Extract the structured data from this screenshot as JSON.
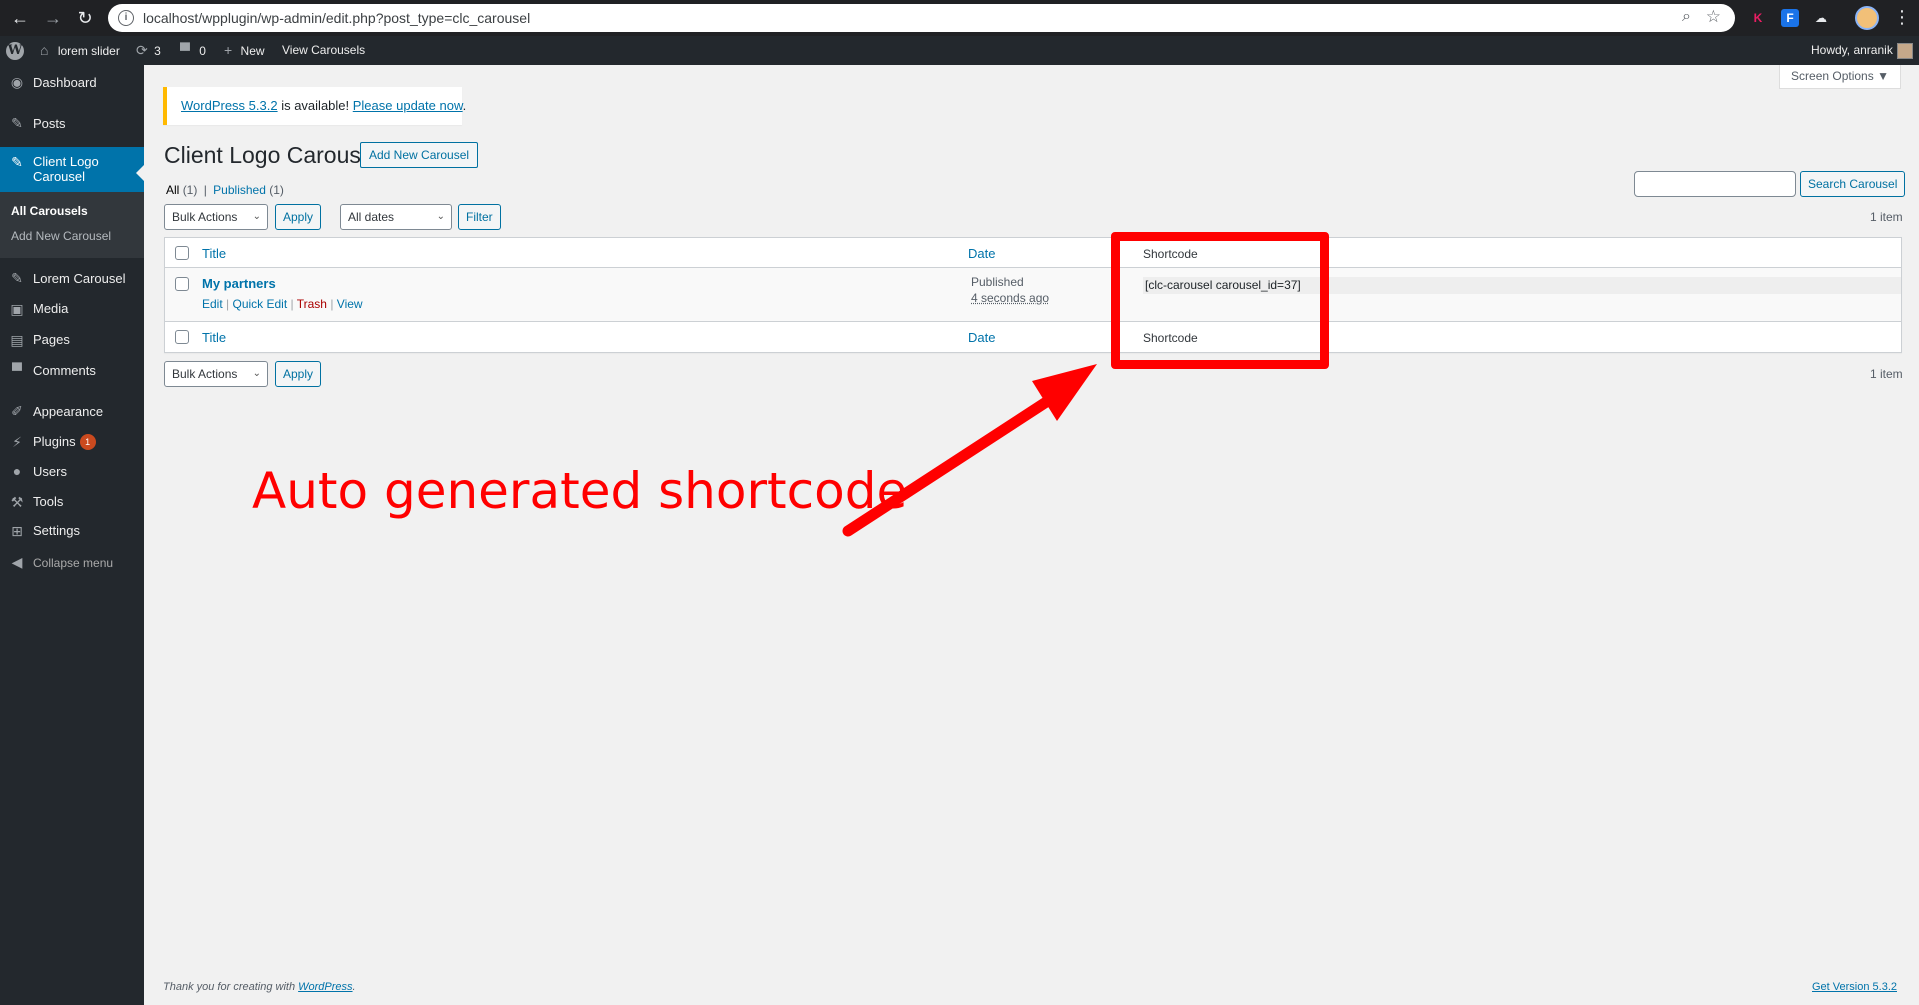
{
  "browser": {
    "url": "localhost/wpplugin/wp-admin/edit.php?post_type=clc_carousel",
    "extensions": [
      "K",
      "F",
      "☁"
    ]
  },
  "adminbar": {
    "site_name": "lorem slider",
    "updates_count": "3",
    "comments_count": "0",
    "new_label": "New",
    "view_label": "View Carousels",
    "howdy": "Howdy, anranik"
  },
  "sidebar": {
    "items": [
      {
        "label": "Dashboard",
        "icon": "dashboard-icon"
      },
      {
        "label": "Posts",
        "icon": "pin-icon"
      },
      {
        "label": "Client Logo Carousel",
        "icon": "pin-icon"
      },
      {
        "label": "Lorem Carousel",
        "icon": "pin-icon"
      },
      {
        "label": "Media",
        "icon": "media-icon"
      },
      {
        "label": "Pages",
        "icon": "pages-icon"
      },
      {
        "label": "Comments",
        "icon": "comment-icon"
      },
      {
        "label": "Appearance",
        "icon": "brush-icon"
      },
      {
        "label": "Plugins",
        "icon": "plugin-icon",
        "badge": "1"
      },
      {
        "label": "Users",
        "icon": "users-icon"
      },
      {
        "label": "Tools",
        "icon": "wrench-icon"
      },
      {
        "label": "Settings",
        "icon": "settings-icon"
      }
    ],
    "submenu": [
      "All Carousels",
      "Add New Carousel"
    ],
    "collapse_label": "Collapse menu"
  },
  "screen_options": "Screen Options",
  "notice": {
    "version_link": "WordPress 5.3.2",
    "middle_text": " is available! ",
    "update_link": "Please update now",
    "end": "."
  },
  "page": {
    "title": "Client Logo Carousel",
    "add_new": "Add New Carousel",
    "filter_all": "All",
    "filter_all_count": "(1)",
    "filter_sep": "|",
    "filter_published": "Published",
    "filter_published_count": "(1)",
    "search_button": "Search Carousel",
    "bulk_actions": "Bulk Actions",
    "apply": "Apply",
    "all_dates": "All dates",
    "filter_button": "Filter",
    "item_count": "1 item"
  },
  "table": {
    "columns": [
      "Title",
      "Date",
      "Shortcode"
    ],
    "rows": [
      {
        "title": "My partners",
        "actions": [
          "Edit",
          "Quick Edit",
          "Trash",
          "View"
        ],
        "date_status": "Published",
        "date_ago": "4 seconds ago",
        "shortcode": "[clc-carousel carousel_id=37]"
      }
    ]
  },
  "annotation": "Auto generated shortcode",
  "footer": {
    "thanks_prefix": "Thank you for creating with ",
    "wordpress_link": "WordPress",
    "thanks_suffix": ".",
    "version": "Get Version 5.3.2"
  },
  "colors": {
    "admin_dark": "#23282d",
    "wp_blue": "#0073aa",
    "annotation_red": "#ff0000",
    "notice_yellow": "#ffb900"
  }
}
